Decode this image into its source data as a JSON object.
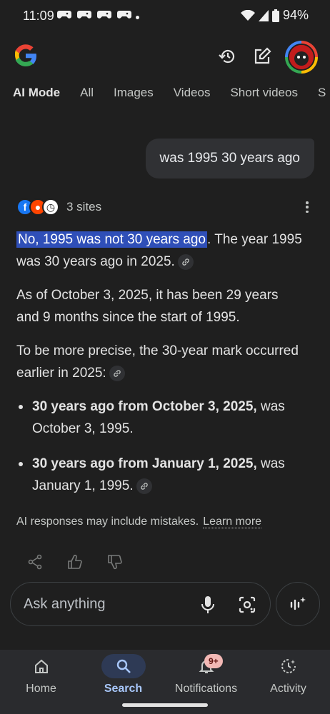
{
  "status_bar": {
    "time": "11:09",
    "battery": "94%"
  },
  "header": {
    "tabs": [
      {
        "label": "AI Mode",
        "active": true
      },
      {
        "label": "All",
        "active": false
      },
      {
        "label": "Images",
        "active": false
      },
      {
        "label": "Videos",
        "active": false
      },
      {
        "label": "Short videos",
        "active": false
      },
      {
        "label": "S",
        "active": false
      }
    ]
  },
  "query": "was 1995 30 years ago",
  "sources": {
    "label": "3 sites"
  },
  "answer": {
    "p1_highlight": "No, 1995 was not 30 years ago",
    "p1_rest": ". The year 1995 was 30 years ago in 2025.",
    "p2": "As of October 3, 2025, it has been 29 years and 9 months since the start of 1995.",
    "p3": "To be more precise, the 30-year mark occurred earlier in 2025:",
    "bullets": [
      {
        "bold": "30 years ago from October 3, 2025,",
        "rest": " was October 3, 1995."
      },
      {
        "bold": "30 years ago from January 1, 2025,",
        "rest": " was January 1, 1995."
      }
    ]
  },
  "disclaimer": {
    "text": "AI responses may include mistakes.",
    "link": "Learn more"
  },
  "input": {
    "placeholder": "Ask anything"
  },
  "bottom_nav": {
    "items": [
      {
        "label": "Home"
      },
      {
        "label": "Search"
      },
      {
        "label": "Notifications"
      },
      {
        "label": "Activity"
      }
    ],
    "notifications_badge": "9+"
  },
  "colors": {
    "background": "#1f1f1f",
    "highlight": "#2f4fb8",
    "nav_active": "#a8c7fa"
  }
}
